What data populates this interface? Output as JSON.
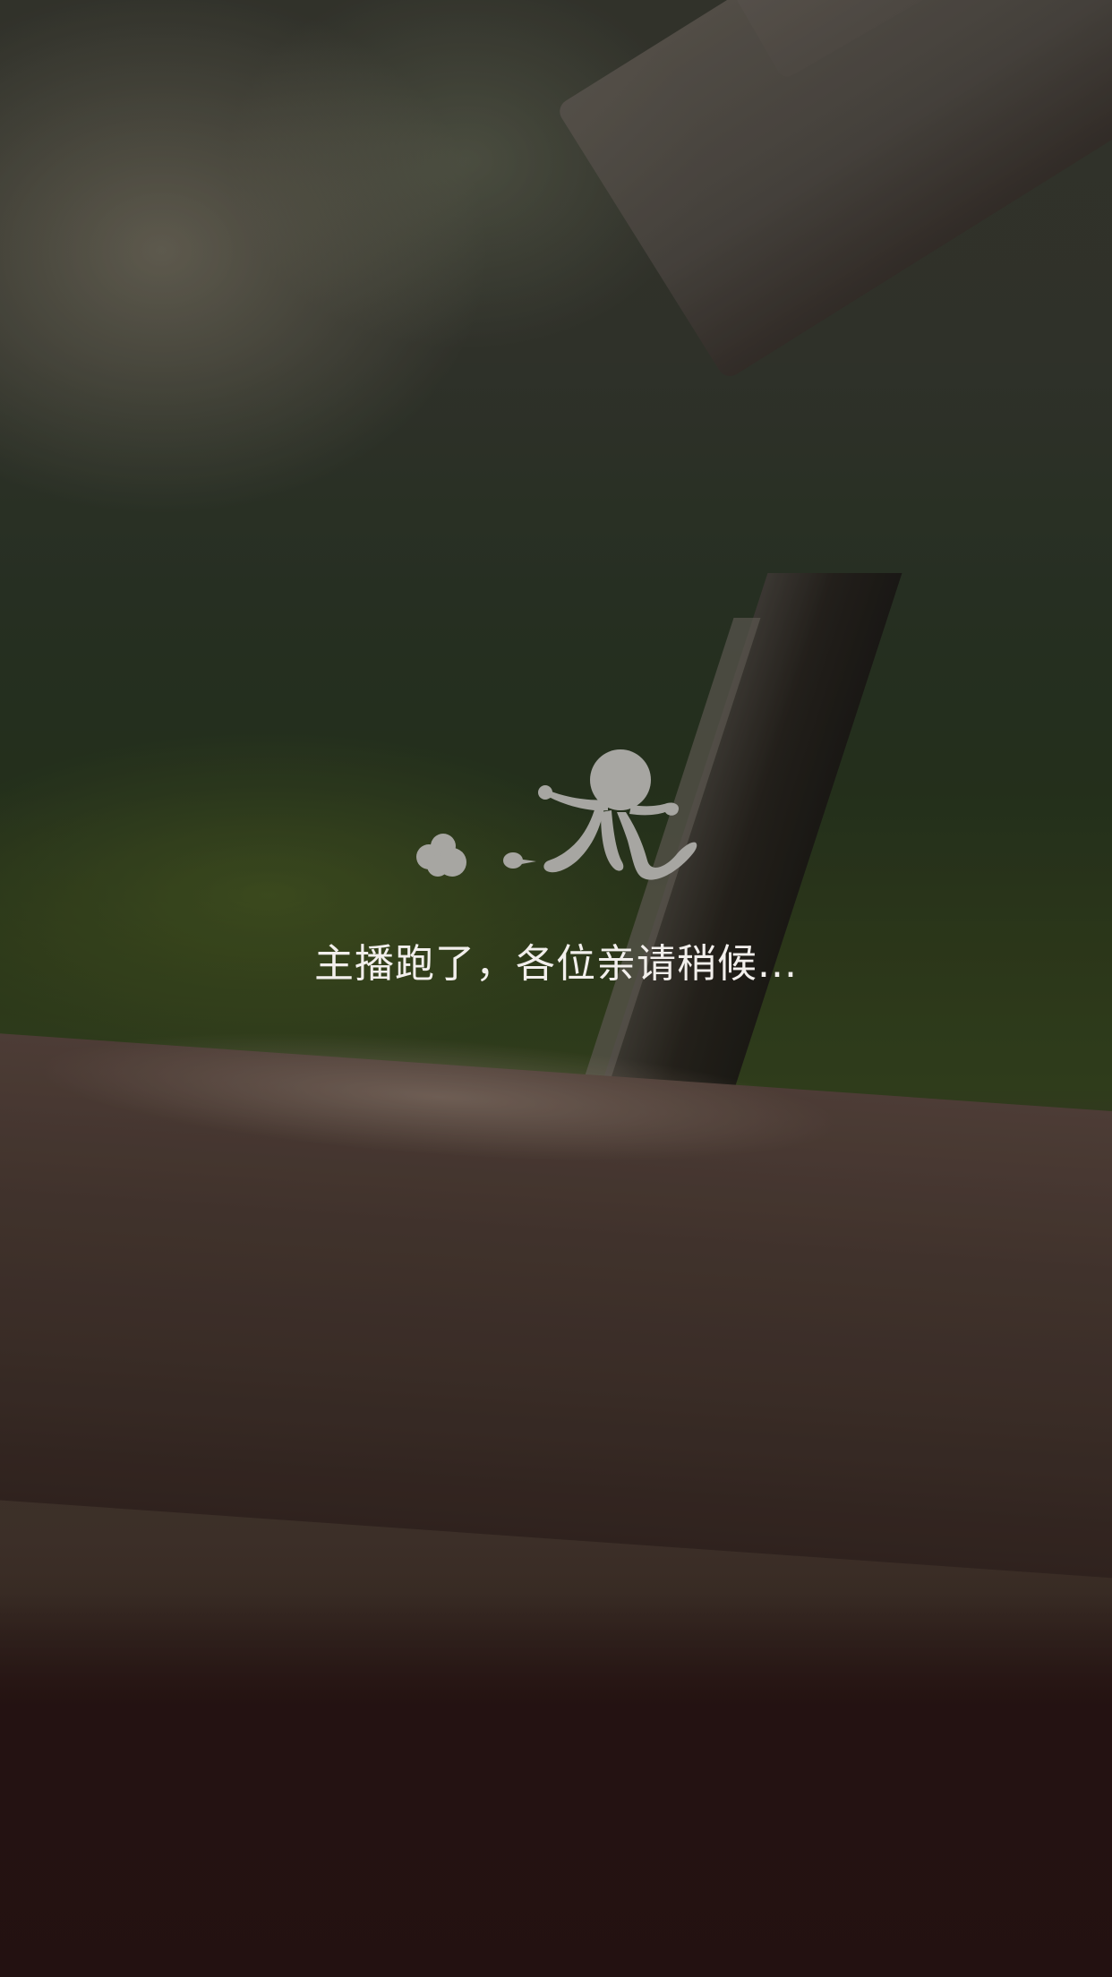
{
  "loading": {
    "message": "主播跑了，各位亲请稍候..."
  },
  "icons": {
    "runner": "running-figure-icon"
  },
  "colors": {
    "icon": "#a7a6a2",
    "text": "#f2efec"
  }
}
